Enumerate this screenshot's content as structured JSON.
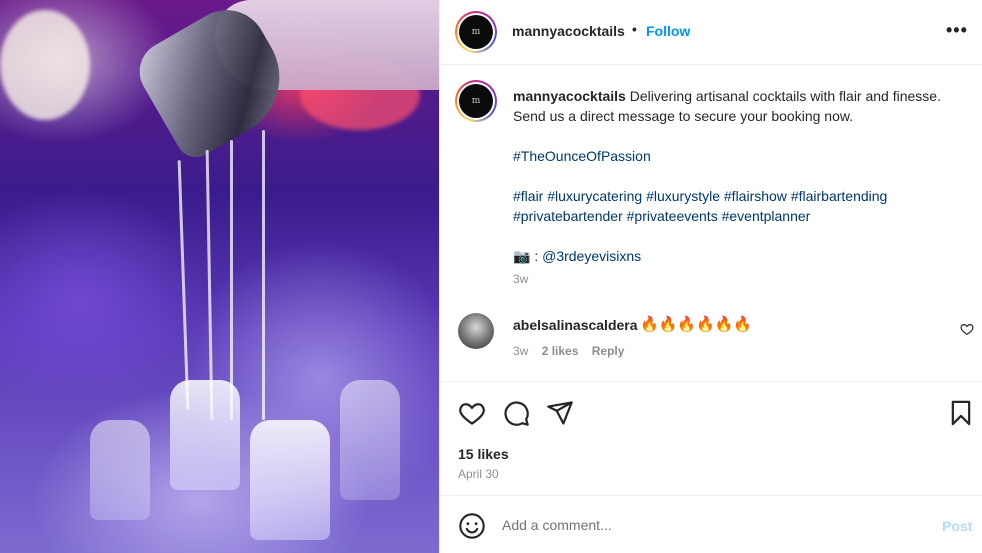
{
  "post": {
    "username": "mannyacocktails",
    "follow_separator": "•",
    "follow_label": "Follow",
    "more_label": "•••",
    "avatar_glyph": "m"
  },
  "caption": {
    "username": "mannyacocktails",
    "text": "Delivering artisanal cocktails with flair and finesse. Send us a direct message to secure your booking now.",
    "hashtag_main": "#TheOunceOfPassion",
    "hashtags": [
      "#flair",
      "#luxurycatering",
      "#luxurystyle",
      "#flairshow",
      "#flairbartending",
      "#privatebartender",
      "#privateevents",
      "#eventplanner"
    ],
    "camera_emoji": "📷",
    "credit_separator": " : ",
    "credit_handle": "@3rdeyevisixns",
    "time": "3w"
  },
  "comment": {
    "username": "abelsalinascaldera",
    "text": "🔥🔥🔥🔥🔥🔥",
    "time": "3w",
    "likes": "2 likes",
    "reply_label": "Reply"
  },
  "engagement": {
    "likes": "15 likes",
    "date": "April 30"
  },
  "add_comment": {
    "emoji_icon": "smiley-icon",
    "placeholder": "Add a comment...",
    "post_label": "Post"
  },
  "colors": {
    "link_blue": "#0095f6",
    "hashtag": "#00376b",
    "muted": "#8e8e8e",
    "post_disabled": "#b3dbff"
  }
}
